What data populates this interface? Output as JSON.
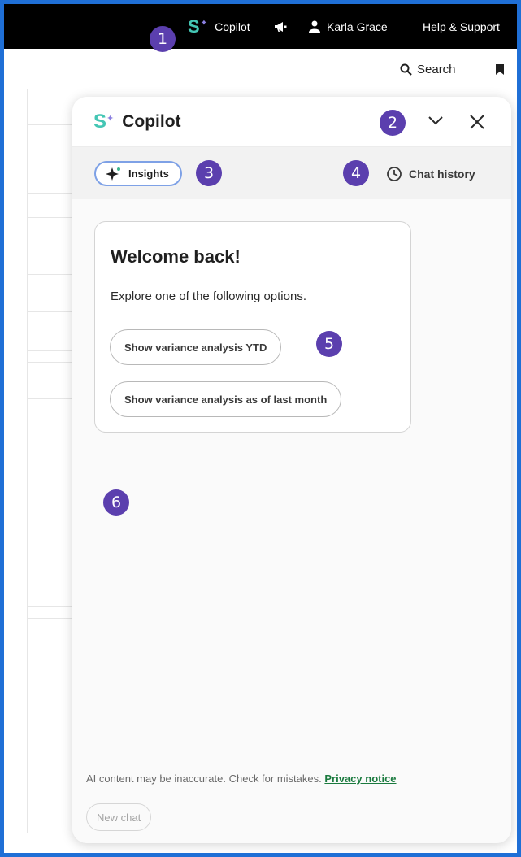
{
  "topbar": {
    "copilot_logo": "S",
    "copilot_label": "Copilot",
    "user_name": "Karla Grace",
    "help_label": "Help & Support"
  },
  "toolbar": {
    "search_label": "Search"
  },
  "panel": {
    "logo": "S",
    "title": "Copilot",
    "insights_label": "Insights",
    "history_label": "Chat history",
    "welcome": {
      "heading": "Welcome back!",
      "subtext": "Explore one of the following options.",
      "options": [
        "Show variance analysis YTD",
        "Show variance analysis as of last month"
      ]
    },
    "footer": {
      "disclaimer": "AI content may be inaccurate. Check for mistakes.",
      "privacy_link": "Privacy notice",
      "new_chat_label": "New chat"
    }
  },
  "callouts": [
    "1",
    "2",
    "3",
    "4",
    "5",
    "6"
  ],
  "colors": {
    "frame_border": "#1f6fd6",
    "callout_bg": "#5b3fae",
    "logo_teal": "#44c6b4",
    "privacy_link": "#1a7a3e"
  }
}
